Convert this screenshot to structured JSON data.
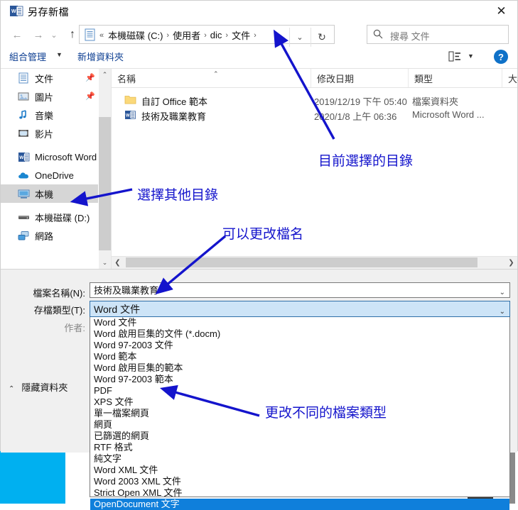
{
  "window": {
    "title": "另存新檔",
    "close_label": "✕",
    "app_icon": "word-icon"
  },
  "nav": {
    "back_icon": "←",
    "forward_icon": "→",
    "recent_icon": "⌄",
    "up_icon": "↑",
    "dropdown_icon": "⌄",
    "refresh_icon": "↻",
    "breadcrumb_prefix": "«",
    "breadcrumbs": [
      "本機磁碟 (C:)",
      "使用者",
      "dic",
      "文件"
    ],
    "separator": "›"
  },
  "search": {
    "placeholder": "搜尋 文件",
    "icon": "search-icon"
  },
  "toolbar": {
    "organize_label": "組合管理",
    "new_folder_label": "新增資料夾",
    "view_icon": "view-layout-icon",
    "help_label": "?"
  },
  "sidebar": {
    "items": [
      {
        "label": "文件",
        "icon": "document-icon",
        "pinned": true,
        "selected": false
      },
      {
        "label": "圖片",
        "icon": "pictures-icon",
        "pinned": true,
        "selected": false
      },
      {
        "label": "音樂",
        "icon": "music-icon",
        "pinned": false,
        "selected": false
      },
      {
        "label": "影片",
        "icon": "video-icon",
        "pinned": false,
        "selected": false
      },
      {
        "label": "Microsoft Word",
        "icon": "word-icon",
        "pinned": false,
        "selected": false
      },
      {
        "label": "OneDrive",
        "icon": "cloud-icon",
        "pinned": false,
        "selected": false
      },
      {
        "label": "本機",
        "icon": "this-pc-icon",
        "pinned": false,
        "selected": true
      },
      {
        "label": "本機磁碟 (D:)",
        "icon": "drive-icon",
        "pinned": false,
        "selected": false
      },
      {
        "label": "網路",
        "icon": "network-icon",
        "pinned": false,
        "selected": false
      }
    ]
  },
  "filelist": {
    "columns": [
      "名稱",
      "修改日期",
      "類型",
      "大小"
    ],
    "rows": [
      {
        "name": "自訂 Office 範本",
        "date": "2019/12/19 下午 05:40",
        "type": "檔案資料夾",
        "icon": "folder-icon"
      },
      {
        "name": "技術及職業教育",
        "date": "2020/1/8 上午 06:36",
        "type": "Microsoft Word ...",
        "icon": "word-doc-icon"
      }
    ]
  },
  "form": {
    "filename_label": "檔案名稱(N):",
    "filename_value": "技術及職業教育",
    "savetype_label": "存檔類型(T):",
    "savetype_value": "Word 文件",
    "author_label": "作者:",
    "hide_folders_label": "隱藏資料夾",
    "hide_folders_caret": "⌃"
  },
  "savetype_options": [
    {
      "label": "Word 文件",
      "selected": false
    },
    {
      "label": "Word 啟用巨集的文件 (*.docm)",
      "selected": false
    },
    {
      "label": "Word 97-2003 文件",
      "selected": false
    },
    {
      "label": "Word 範本",
      "selected": false
    },
    {
      "label": "Word 啟用巨集的範本",
      "selected": false
    },
    {
      "label": "Word 97-2003 範本",
      "selected": false
    },
    {
      "label": "PDF",
      "selected": false
    },
    {
      "label": "XPS 文件",
      "selected": false
    },
    {
      "label": "單一檔案網頁",
      "selected": false
    },
    {
      "label": "網頁",
      "selected": false
    },
    {
      "label": "已篩選的網頁",
      "selected": false
    },
    {
      "label": "RTF 格式",
      "selected": false
    },
    {
      "label": "純文字",
      "selected": false
    },
    {
      "label": "Word XML 文件",
      "selected": false
    },
    {
      "label": "Word 2003 XML 文件",
      "selected": false
    },
    {
      "label": "Strict Open XML 文件",
      "selected": false
    },
    {
      "label": "OpenDocument 文字",
      "selected": true
    }
  ],
  "annotations": {
    "current_directory": "目前選擇的目錄",
    "other_directory": "選擇其他目錄",
    "change_filename": "可以更改檔名",
    "change_filetype": "更改不同的檔案類型",
    "color": "#1414cc"
  }
}
